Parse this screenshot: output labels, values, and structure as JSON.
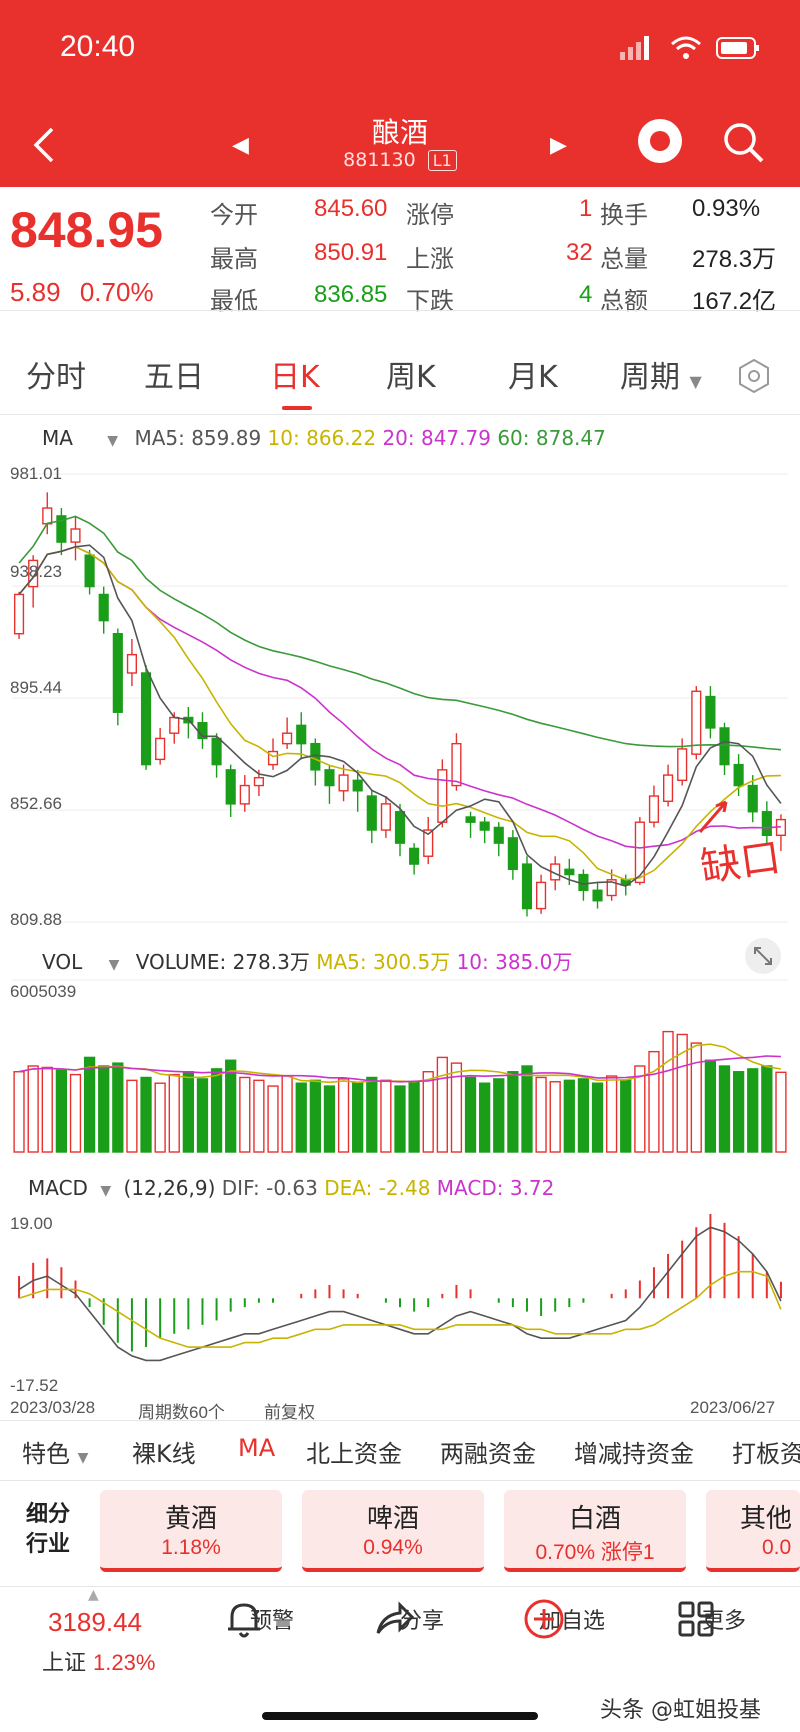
{
  "status": {
    "time": "20:40"
  },
  "header": {
    "title": "酿酒",
    "code": "881130",
    "level": "L1"
  },
  "quote": {
    "price": "848.95",
    "change": "5.89",
    "change_pct": "0.70%",
    "rows": [
      {
        "l1": "今开",
        "v1": "845.60",
        "l2": "涨停",
        "v2": "1",
        "l3": "换手",
        "v3": "0.93%"
      },
      {
        "l1": "最高",
        "v1": "850.91",
        "l2": "上涨",
        "v2": "32",
        "l3": "总量",
        "v3": "278.3万"
      },
      {
        "l1": "最低",
        "v1": "836.85",
        "l2": "下跌",
        "v2": "4",
        "l3": "总额",
        "v3": "167.2亿"
      }
    ]
  },
  "tabs": [
    "分时",
    "五日",
    "日K",
    "周K",
    "月K",
    "周期"
  ],
  "active_tab": "日K",
  "ma_legend": {
    "name": "MA",
    "ma5": "MA5: 859.89",
    "ma10": "10: 866.22",
    "ma20": "20: 847.79",
    "ma60": "60: 878.47"
  },
  "vol_legend": {
    "name": "VOL",
    "volume": "VOLUME: 278.3万",
    "ma5": "MA5: 300.5万",
    "ma10": "10: 385.0万"
  },
  "macd_legend": {
    "name": "MACD",
    "params": "(12,26,9)",
    "dif": "DIF: -0.63",
    "dea": "DEA: -2.48",
    "macd": "MACD: 3.72"
  },
  "price_axis": [
    "981.01",
    "938.23",
    "895.44",
    "852.66",
    "809.88"
  ],
  "vol_axis": "6005039",
  "macd_axis": [
    "19.00",
    "-17.52"
  ],
  "date_start": "2023/03/28",
  "date_end": "2023/06/27",
  "period_count": "周期数60个",
  "adjust": "前复权",
  "annotation": "缺口",
  "toolbar": [
    "特色",
    "裸K线",
    "MA",
    "北上资金",
    "两融资金",
    "增减持资金",
    "打板资"
  ],
  "sector_title": "细分行业",
  "sectors": [
    {
      "name": "黄酒",
      "pct": "1.18%"
    },
    {
      "name": "啤酒",
      "pct": "0.94%"
    },
    {
      "name": "白酒",
      "pct": "0.70%  涨停1"
    },
    {
      "name": "其他",
      "pct": "0.0"
    }
  ],
  "index": {
    "value": "3189.44",
    "name": "上证",
    "pct": "1.23%"
  },
  "nav": [
    "预警",
    "分享",
    "加自选",
    "更多"
  ],
  "watermark": "头条 @虹姐投基",
  "colors": {
    "red": "#e8302d",
    "green": "#1a9e1a",
    "ma5": "#555555",
    "ma10": "#c8b400",
    "ma20": "#cc33cc",
    "ma60": "#3a9a3a"
  },
  "chart_data": {
    "type": "candlestick",
    "ylim": [
      809.88,
      981.01
    ],
    "candles": [
      [
        920,
        935,
        936,
        918
      ],
      [
        938,
        948,
        950,
        930
      ],
      [
        962,
        968,
        974,
        958
      ],
      [
        965,
        955,
        968,
        950
      ],
      [
        955,
        960,
        965,
        948
      ],
      [
        950,
        938,
        952,
        935
      ],
      [
        935,
        925,
        938,
        920
      ],
      [
        920,
        890,
        922,
        885
      ],
      [
        905,
        912,
        918,
        900
      ],
      [
        905,
        870,
        908,
        868
      ],
      [
        872,
        880,
        884,
        870
      ],
      [
        882,
        888,
        890,
        878
      ],
      [
        888,
        886,
        892,
        880
      ],
      [
        886,
        880,
        890,
        876
      ],
      [
        880,
        870,
        882,
        865
      ],
      [
        868,
        855,
        870,
        850
      ],
      [
        855,
        862,
        866,
        852
      ],
      [
        862,
        865,
        868,
        858
      ],
      [
        870,
        875,
        880,
        868
      ],
      [
        878,
        882,
        888,
        876
      ],
      [
        885,
        878,
        890,
        872
      ],
      [
        878,
        868,
        880,
        862
      ],
      [
        868,
        862,
        870,
        855
      ],
      [
        860,
        866,
        870,
        856
      ],
      [
        864,
        860,
        868,
        852
      ],
      [
        858,
        845,
        860,
        840
      ],
      [
        845,
        855,
        858,
        842
      ],
      [
        852,
        840,
        855,
        835
      ],
      [
        838,
        832,
        840,
        828
      ],
      [
        835,
        845,
        850,
        832
      ],
      [
        848,
        868,
        872,
        846
      ],
      [
        862,
        878,
        882,
        860
      ],
      [
        850,
        848,
        852,
        842
      ],
      [
        848,
        845,
        850,
        840
      ],
      [
        846,
        840,
        848,
        835
      ],
      [
        842,
        830,
        845,
        826
      ],
      [
        832,
        815,
        835,
        812
      ],
      [
        815,
        825,
        828,
        813
      ],
      [
        826,
        832,
        835,
        822
      ],
      [
        830,
        828,
        834,
        824
      ],
      [
        828,
        822,
        830,
        818
      ],
      [
        822,
        818,
        825,
        815
      ],
      [
        820,
        826,
        830,
        818
      ],
      [
        826,
        824,
        828,
        820
      ],
      [
        825,
        848,
        850,
        824
      ],
      [
        848,
        858,
        862,
        846
      ],
      [
        856,
        866,
        870,
        854
      ],
      [
        864,
        876,
        880,
        862
      ],
      [
        874,
        898,
        900,
        872
      ],
      [
        896,
        884,
        900,
        880
      ],
      [
        884,
        870,
        886,
        866
      ],
      [
        870,
        862,
        874,
        858
      ],
      [
        862,
        852,
        866,
        848
      ],
      [
        852,
        843,
        856,
        840
      ],
      [
        843,
        849,
        851,
        837
      ]
    ],
    "volume": [
      280,
      300,
      295,
      285,
      270,
      330,
      300,
      310,
      250,
      260,
      240,
      270,
      280,
      255,
      290,
      320,
      260,
      250,
      230,
      265,
      240,
      250,
      230,
      255,
      240,
      260,
      250,
      230,
      245,
      280,
      330,
      310,
      260,
      240,
      255,
      280,
      300,
      260,
      245,
      250,
      255,
      240,
      265,
      250,
      300,
      350,
      420,
      410,
      380,
      320,
      300,
      280,
      290,
      300,
      278
    ],
    "macd_hist": [
      5,
      8,
      9,
      7,
      4,
      -2,
      -6,
      -10,
      -12,
      -11,
      -9,
      -8,
      -7,
      -6,
      -5,
      -3,
      -2,
      -1,
      -1,
      0,
      1,
      2,
      3,
      2,
      1,
      0,
      -1,
      -2,
      -3,
      -2,
      1,
      3,
      2,
      0,
      -1,
      -2,
      -3,
      -4,
      -3,
      -2,
      -1,
      0,
      1,
      2,
      4,
      7,
      10,
      13,
      16,
      19,
      17,
      14,
      10,
      6,
      3.72
    ],
    "dif": [
      2,
      4,
      5,
      3,
      1,
      -3,
      -7,
      -11,
      -13,
      -14,
      -14,
      -13,
      -12,
      -11,
      -10,
      -9,
      -8,
      -8,
      -7,
      -6,
      -5,
      -4,
      -3,
      -3,
      -4,
      -5,
      -6,
      -7,
      -8,
      -8,
      -6,
      -4,
      -3,
      -4,
      -5,
      -6,
      -8,
      -9,
      -9,
      -9,
      -8,
      -7,
      -6,
      -5,
      -2,
      2,
      6,
      10,
      14,
      16,
      15,
      13,
      10,
      6,
      -0.63
    ],
    "dea": [
      0,
      1,
      2,
      2,
      2,
      1,
      -1,
      -3,
      -5,
      -7,
      -9,
      -10,
      -11,
      -11,
      -11,
      -11,
      -10,
      -10,
      -9,
      -9,
      -8,
      -7,
      -7,
      -6,
      -6,
      -6,
      -6,
      -6,
      -7,
      -7,
      -7,
      -6,
      -6,
      -6,
      -6,
      -6,
      -7,
      -7,
      -8,
      -8,
      -8,
      -8,
      -8,
      -7,
      -7,
      -6,
      -4,
      -2,
      0,
      3,
      5,
      6,
      6,
      5,
      -2.48
    ]
  }
}
